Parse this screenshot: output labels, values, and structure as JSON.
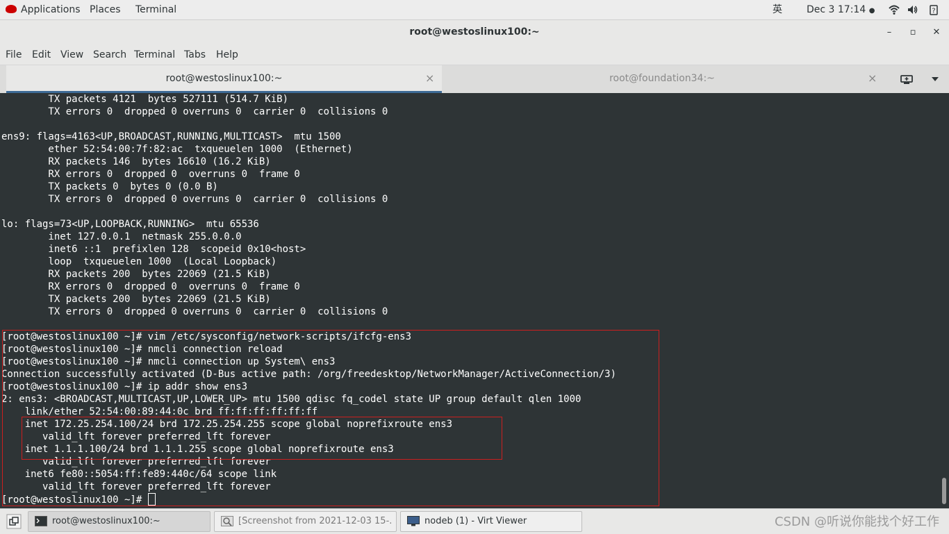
{
  "top_panel": {
    "applications": "Applications",
    "places": "Places",
    "terminal": "Terminal",
    "input_method": "英",
    "clock": "Dec 3  17:14",
    "icons": [
      "redhat-icon",
      "wifi-icon",
      "volume-icon",
      "power-icon"
    ]
  },
  "window": {
    "title": "root@westoslinux100:~",
    "buttons": {
      "minimize": "–",
      "maximize": "▫",
      "close": "✕"
    }
  },
  "menubar": [
    "File",
    "Edit",
    "View",
    "Search",
    "Terminal",
    "Tabs",
    "Help"
  ],
  "tabs": [
    {
      "label": "root@westoslinux100:~",
      "active": true
    },
    {
      "label": "root@foundation34:~",
      "active": false
    }
  ],
  "terminal": {
    "lines": [
      "        TX packets 4121  bytes 527111 (514.7 KiB)",
      "        TX errors 0  dropped 0 overruns 0  carrier 0  collisions 0",
      "",
      "ens9: flags=4163<UP,BROADCAST,RUNNING,MULTICAST>  mtu 1500",
      "        ether 52:54:00:7f:82:ac  txqueuelen 1000  (Ethernet)",
      "        RX packets 146  bytes 16610 (16.2 KiB)",
      "        RX errors 0  dropped 0  overruns 0  frame 0",
      "        TX packets 0  bytes 0 (0.0 B)",
      "        TX errors 0  dropped 0 overruns 0  carrier 0  collisions 0",
      "",
      "lo: flags=73<UP,LOOPBACK,RUNNING>  mtu 65536",
      "        inet 127.0.0.1  netmask 255.0.0.0",
      "        inet6 ::1  prefixlen 128  scopeid 0x10<host>",
      "        loop  txqueuelen 1000  (Local Loopback)",
      "        RX packets 200  bytes 22069 (21.5 KiB)",
      "        RX errors 0  dropped 0  overruns 0  frame 0",
      "        TX packets 200  bytes 22069 (21.5 KiB)",
      "        TX errors 0  dropped 0 overruns 0  carrier 0  collisions 0",
      "",
      "[root@westoslinux100 ~]# vim /etc/sysconfig/network-scripts/ifcfg-ens3",
      "[root@westoslinux100 ~]# nmcli connection reload",
      "[root@westoslinux100 ~]# nmcli connection up System\\ ens3",
      "Connection successfully activated (D-Bus active path: /org/freedesktop/NetworkManager/ActiveConnection/3)",
      "[root@westoslinux100 ~]# ip addr show ens3",
      "2: ens3: <BROADCAST,MULTICAST,UP,LOWER_UP> mtu 1500 qdisc fq_codel state UP group default qlen 1000",
      "    link/ether 52:54:00:89:44:0c brd ff:ff:ff:ff:ff:ff",
      "    inet 172.25.254.100/24 brd 172.25.254.255 scope global noprefixroute ens3",
      "       valid_lft forever preferred_lft forever",
      "    inet 1.1.1.100/24 brd 1.1.1.255 scope global noprefixroute ens3",
      "       valid_lft forever preferred_lft forever",
      "    inet6 fe80::5054:ff:fe89:440c/64 scope link",
      "       valid_lft forever preferred_lft forever"
    ],
    "prompt": "[root@westoslinux100 ~]# "
  },
  "taskbar": {
    "items": [
      {
        "label": "root@westoslinux100:~",
        "icon": "terminal-icon"
      },
      {
        "label": "[Screenshot from 2021-12-03 15-...",
        "icon": "screenshot-icon"
      },
      {
        "label": "nodeb (1) - Virt Viewer",
        "icon": "virt-viewer-icon"
      }
    ],
    "watermark": "CSDN @听说你能找个好工作"
  },
  "colors": {
    "terminal_bg": "#2e3436",
    "highlight": "#cc1f1f",
    "tab_indicator": "#3d6a96"
  }
}
